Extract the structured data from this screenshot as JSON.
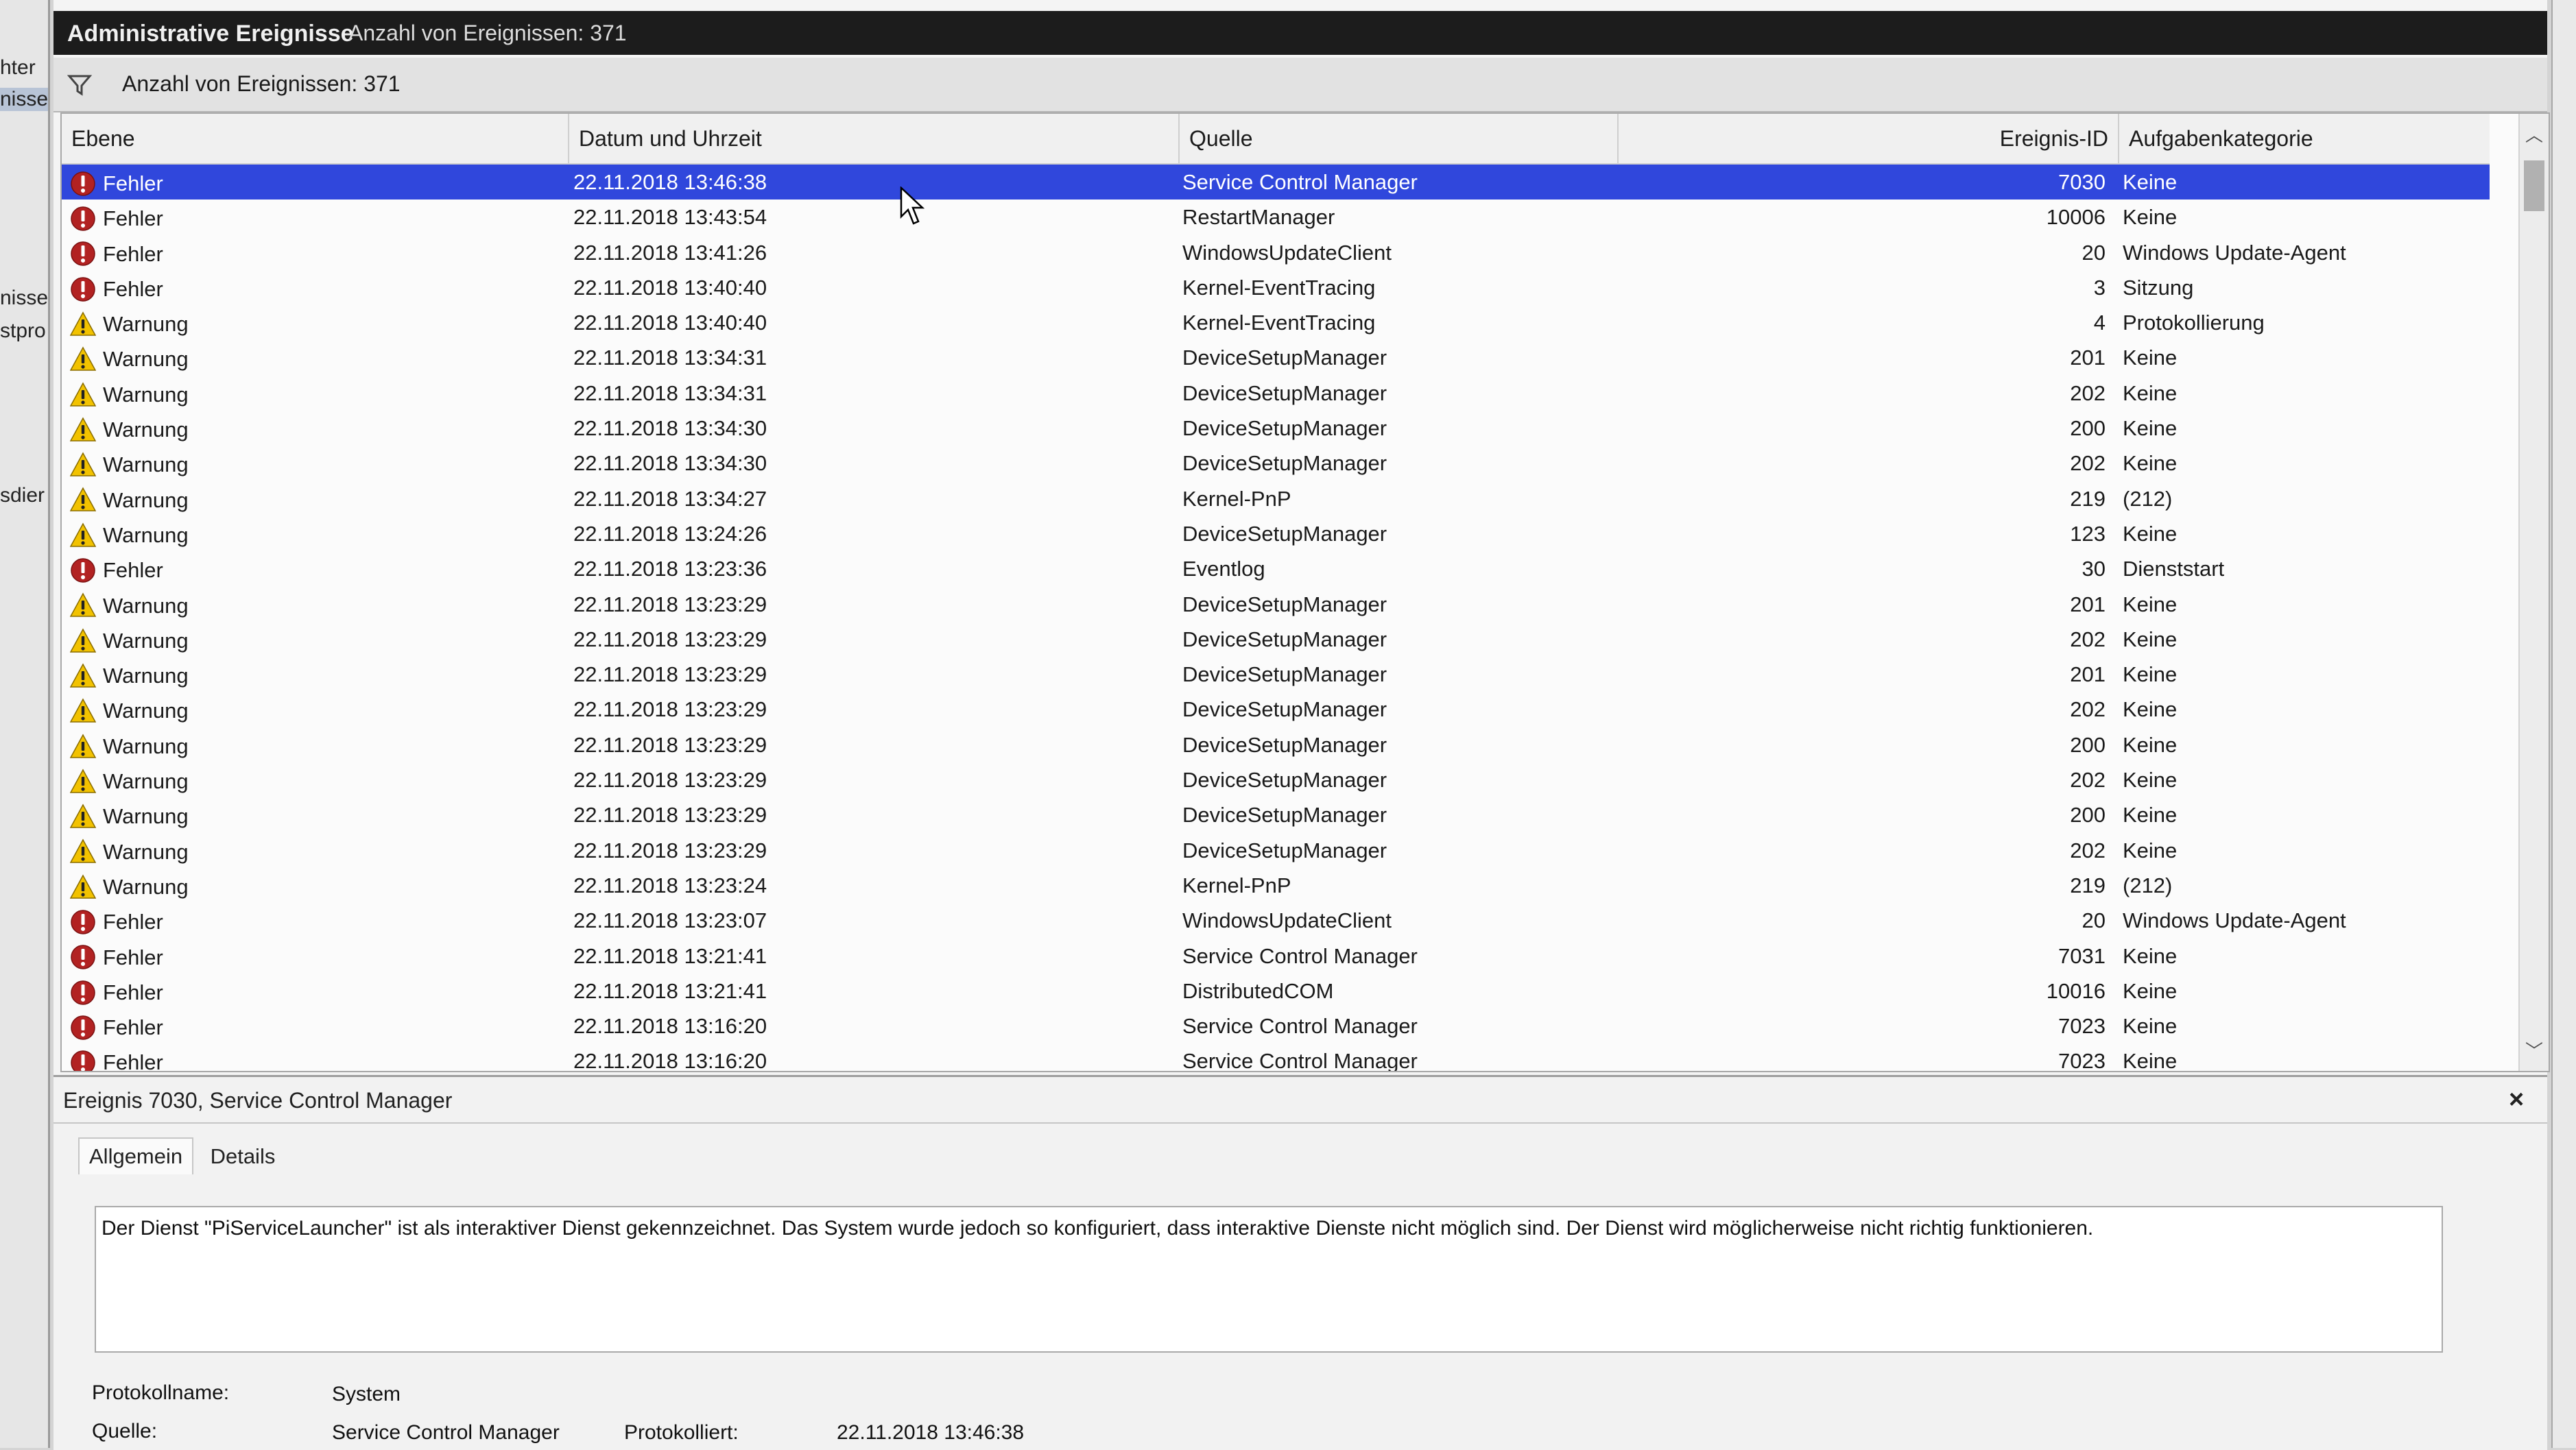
{
  "left_tree": [
    "hter",
    "nisse",
    "nisse",
    "stpro",
    "sdier"
  ],
  "window": {
    "title": "Administrative Ereignisse",
    "count": "Anzahl von Ereignissen: 371"
  },
  "filter": {
    "text": "Anzahl von Ereignissen: 371"
  },
  "columns": [
    "Ebene",
    "Datum und Uhrzeit",
    "Quelle",
    "Ereignis-ID",
    "Aufgabenkategorie"
  ],
  "events": [
    {
      "level": "Fehler",
      "icon": "error",
      "date": "22.11.2018 13:46:38",
      "source": "Service Control Manager",
      "id": "7030",
      "category": "Keine"
    },
    {
      "level": "Fehler",
      "icon": "error",
      "date": "22.11.2018 13:43:54",
      "source": "RestartManager",
      "id": "10006",
      "category": "Keine"
    },
    {
      "level": "Fehler",
      "icon": "error",
      "date": "22.11.2018 13:41:26",
      "source": "WindowsUpdateClient",
      "id": "20",
      "category": "Windows Update-Agent"
    },
    {
      "level": "Fehler",
      "icon": "error",
      "date": "22.11.2018 13:40:40",
      "source": "Kernel-EventTracing",
      "id": "3",
      "category": "Sitzung"
    },
    {
      "level": "Warnung",
      "icon": "warning",
      "date": "22.11.2018 13:40:40",
      "source": "Kernel-EventTracing",
      "id": "4",
      "category": "Protokollierung"
    },
    {
      "level": "Warnung",
      "icon": "warning",
      "date": "22.11.2018 13:34:31",
      "source": "DeviceSetupManager",
      "id": "201",
      "category": "Keine"
    },
    {
      "level": "Warnung",
      "icon": "warning",
      "date": "22.11.2018 13:34:31",
      "source": "DeviceSetupManager",
      "id": "202",
      "category": "Keine"
    },
    {
      "level": "Warnung",
      "icon": "warning",
      "date": "22.11.2018 13:34:30",
      "source": "DeviceSetupManager",
      "id": "200",
      "category": "Keine"
    },
    {
      "level": "Warnung",
      "icon": "warning",
      "date": "22.11.2018 13:34:30",
      "source": "DeviceSetupManager",
      "id": "202",
      "category": "Keine"
    },
    {
      "level": "Warnung",
      "icon": "warning",
      "date": "22.11.2018 13:34:27",
      "source": "Kernel-PnP",
      "id": "219",
      "category": "(212)"
    },
    {
      "level": "Warnung",
      "icon": "warning",
      "date": "22.11.2018 13:24:26",
      "source": "DeviceSetupManager",
      "id": "123",
      "category": "Keine"
    },
    {
      "level": "Fehler",
      "icon": "error",
      "date": "22.11.2018 13:23:36",
      "source": "Eventlog",
      "id": "30",
      "category": "Dienststart"
    },
    {
      "level": "Warnung",
      "icon": "warning",
      "date": "22.11.2018 13:23:29",
      "source": "DeviceSetupManager",
      "id": "201",
      "category": "Keine"
    },
    {
      "level": "Warnung",
      "icon": "warning",
      "date": "22.11.2018 13:23:29",
      "source": "DeviceSetupManager",
      "id": "202",
      "category": "Keine"
    },
    {
      "level": "Warnung",
      "icon": "warning",
      "date": "22.11.2018 13:23:29",
      "source": "DeviceSetupManager",
      "id": "201",
      "category": "Keine"
    },
    {
      "level": "Warnung",
      "icon": "warning",
      "date": "22.11.2018 13:23:29",
      "source": "DeviceSetupManager",
      "id": "202",
      "category": "Keine"
    },
    {
      "level": "Warnung",
      "icon": "warning",
      "date": "22.11.2018 13:23:29",
      "source": "DeviceSetupManager",
      "id": "200",
      "category": "Keine"
    },
    {
      "level": "Warnung",
      "icon": "warning",
      "date": "22.11.2018 13:23:29",
      "source": "DeviceSetupManager",
      "id": "202",
      "category": "Keine"
    },
    {
      "level": "Warnung",
      "icon": "warning",
      "date": "22.11.2018 13:23:29",
      "source": "DeviceSetupManager",
      "id": "200",
      "category": "Keine"
    },
    {
      "level": "Warnung",
      "icon": "warning",
      "date": "22.11.2018 13:23:29",
      "source": "DeviceSetupManager",
      "id": "202",
      "category": "Keine"
    },
    {
      "level": "Warnung",
      "icon": "warning",
      "date": "22.11.2018 13:23:24",
      "source": "Kernel-PnP",
      "id": "219",
      "category": "(212)"
    },
    {
      "level": "Fehler",
      "icon": "error",
      "date": "22.11.2018 13:23:07",
      "source": "WindowsUpdateClient",
      "id": "20",
      "category": "Windows Update-Agent"
    },
    {
      "level": "Fehler",
      "icon": "error",
      "date": "22.11.2018 13:21:41",
      "source": "Service Control Manager",
      "id": "7031",
      "category": "Keine"
    },
    {
      "level": "Fehler",
      "icon": "error",
      "date": "22.11.2018 13:21:41",
      "source": "DistributedCOM",
      "id": "10016",
      "category": "Keine"
    },
    {
      "level": "Fehler",
      "icon": "error",
      "date": "22.11.2018 13:16:20",
      "source": "Service Control Manager",
      "id": "7023",
      "category": "Keine"
    },
    {
      "level": "Fehler",
      "icon": "error",
      "date": "22.11.2018 13:16:20",
      "source": "Service Control Manager",
      "id": "7023",
      "category": "Keine"
    }
  ],
  "selected_index": 0,
  "detail": {
    "title": "Ereignis 7030, Service Control Manager",
    "close": "×",
    "tabs": [
      "Allgemein",
      "Details"
    ],
    "message": "Der Dienst \"PiServiceLauncher\" ist als interaktiver Dienst gekennzeichnet. Das System wurde jedoch so konfiguriert, dass interaktive Dienste nicht möglich sind. Der Dienst wird möglicherweise nicht richtig funktionieren.",
    "fields": {
      "protokollname_label": "Protokollname:",
      "protokollname_value": "System",
      "quelle_label": "Quelle:",
      "quelle_value": "Service Control Manager",
      "protokolliert_label": "Protokolliert:",
      "protokolliert_value": "22.11.2018 13:46:38"
    }
  },
  "colors": {
    "selection": "#3047dc",
    "error_icon": "#b22222",
    "warning_icon": "#f2c200",
    "titlebar": "#1c1c1c"
  }
}
